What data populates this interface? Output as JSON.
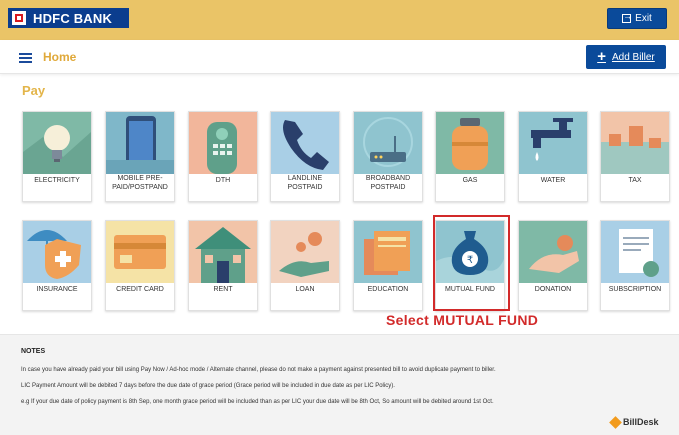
{
  "topbar": {
    "bank_name": "HDFC BANK",
    "exit_label": "Exit"
  },
  "header": {
    "title": "Home",
    "add_biller_label": "Add Biller"
  },
  "section": {
    "title": "Pay"
  },
  "tiles": [
    {
      "label": "ELECTRICITY",
      "icon": "bulb-icon"
    },
    {
      "label": "MOBILE PRE-PAID/POSTPAND",
      "icon": "mobile-icon"
    },
    {
      "label": "DTH",
      "icon": "remote-icon"
    },
    {
      "label": "LANDLINE POSTPAID",
      "icon": "telephone-icon"
    },
    {
      "label": "BROADBAND POSTPAID",
      "icon": "router-icon"
    },
    {
      "label": "GAS",
      "icon": "gas-cylinder-icon"
    },
    {
      "label": "WATER",
      "icon": "tap-icon"
    },
    {
      "label": "TAX",
      "icon": "tax-icon"
    },
    {
      "label": "INSURANCE",
      "icon": "umbrella-shield-icon"
    },
    {
      "label": "CREDIT CARD",
      "icon": "credit-card-icon"
    },
    {
      "label": "RENT",
      "icon": "house-icon"
    },
    {
      "label": "LOAN",
      "icon": "coins-hand-icon"
    },
    {
      "label": "EDUCATION",
      "icon": "books-icon"
    },
    {
      "label": "MUTUAL FUND",
      "icon": "money-bag-icon"
    },
    {
      "label": "DONATION",
      "icon": "donation-hand-icon"
    },
    {
      "label": "SUBSCRIPTION",
      "icon": "subscription-icon"
    }
  ],
  "tile_lines": [
    [
      "ELECTRICITY"
    ],
    [
      "MOBILE PRE-",
      "PAID/POSTPAND"
    ],
    [
      "DTH"
    ],
    [
      "LANDLINE",
      "POSTPAID"
    ],
    [
      "BROADBAND",
      "POSTPAID"
    ],
    [
      "GAS"
    ],
    [
      "WATER"
    ],
    [
      "TAX"
    ],
    [
      "INSURANCE"
    ],
    [
      "CREDIT CARD"
    ],
    [
      "RENT"
    ],
    [
      "LOAN"
    ],
    [
      "EDUCATION"
    ],
    [
      "MUTUAL FUND"
    ],
    [
      "DONATION"
    ],
    [
      "SUBSCRIPTION"
    ]
  ],
  "annotation": {
    "text": "Select MUTUAL FUND",
    "color": "#d22a2a"
  },
  "notes": {
    "title": "NOTES",
    "lines": [
      "In case you have already paid your bill using Pay Now / Ad-hoc mode / Alternate channel, please do not make a payment against presented bill to avoid duplicate payment to biller.",
      "LIC Payment Amount will be debited 7 days before the due date of grace period (Grace period will be included in due date as per LIC Policy).",
      "e.g If your due date of policy payment is 8th Sep, one month grace period will be included than as per LIC your due date will be 8th Oct, So amount will be debited around 1st Oct."
    ]
  },
  "footer": {
    "brand": "BillDesk"
  },
  "colors": {
    "topbar": "#eac467",
    "primary": "#0a4a9a",
    "accent": "#e0a93a",
    "highlight": "#d22a2a"
  }
}
